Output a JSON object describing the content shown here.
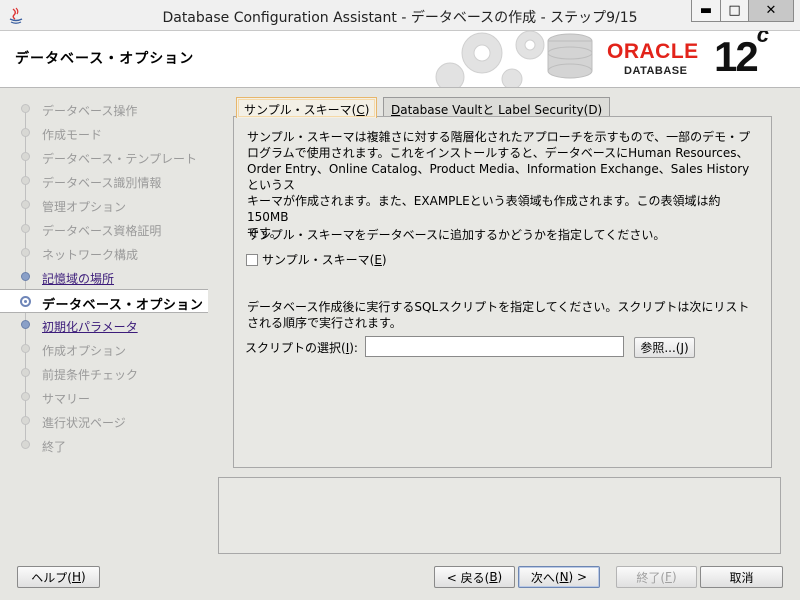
{
  "window": {
    "title": "Database Configuration Assistant - データベースの作成 - ステップ9/15",
    "minimize_glyph": "▬",
    "maximize_glyph": "□",
    "close_glyph": "✕"
  },
  "header": {
    "title": "データベース・オプション",
    "brand": "ORACLE",
    "brand_sub": "DATABASE",
    "version": "12",
    "version_suffix": "c"
  },
  "steps": [
    {
      "label": "データベース操作",
      "state": "disabled"
    },
    {
      "label": "作成モード",
      "state": "disabled"
    },
    {
      "label": "データベース・テンプレート",
      "state": "disabled"
    },
    {
      "label": "データベース識別情報",
      "state": "disabled"
    },
    {
      "label": "管理オプション",
      "state": "disabled"
    },
    {
      "label": "データベース資格証明",
      "state": "disabled"
    },
    {
      "label": "ネットワーク構成",
      "state": "disabled"
    },
    {
      "label": "記憶域の場所",
      "state": "link"
    },
    {
      "label": "データベース・オプション",
      "state": "current"
    },
    {
      "label": "初期化パラメータ",
      "state": "link"
    },
    {
      "label": "作成オプション",
      "state": "disabled"
    },
    {
      "label": "前提条件チェック",
      "state": "disabled"
    },
    {
      "label": "サマリー",
      "state": "disabled"
    },
    {
      "label": "進行状況ページ",
      "state": "disabled"
    },
    {
      "label": "終了",
      "state": "disabled"
    }
  ],
  "tabs": [
    {
      "label": "サンプル・スキーマ(",
      "mnemonic": "C",
      "suffix": ")",
      "active": true
    },
    {
      "label": "",
      "mnemonic": "D",
      "label_rest": "atabase Vaultと Label Security(",
      "suffix": "D)",
      "active": false
    }
  ],
  "tab_labels": {
    "sample_prefix": "サンプル・スキーマ(",
    "sample_key": "C",
    "sample_suffix": ")",
    "vault_key": "D",
    "vault_rest": "atabase Vaultと Label Security(D)"
  },
  "panel": {
    "description_line1": "サンプル・スキーマは複雑さに対する階層化されたアプローチを示すもので、一部のデモ・プ",
    "description_line2": "ログラムで使用されます。これをインストールすると、データベースにHuman Resources、",
    "description_line3": "Order Entry、Online Catalog、Product Media、Information Exchange、Sales Historyというス",
    "description_line4": "キーマが作成されます。また、EXAMPLEという表領域も作成されます。この表領域は約150MB",
    "description_line5": "です。",
    "add_prompt": "サンプル・スキーマをデータベースに追加するかどうかを指定してください。",
    "checkbox_label": "サンプル・スキーマ(",
    "checkbox_key": "E",
    "checkbox_suffix": ")",
    "checkbox_checked": false,
    "sql_prompt_line1": "データベース作成後に実行するSQLスクリプトを指定してください。スクリプトは次にリスト",
    "sql_prompt_line2": "される順序で実行されます。",
    "script_label": "スクリプトの選択(",
    "script_key": "I",
    "script_suffix": "):",
    "script_value": "",
    "browse_label": "参照...(",
    "browse_key": "J",
    "browse_suffix": ")"
  },
  "buttons": {
    "help": "ヘルプ(",
    "help_key": "H",
    "help_suffix": ")",
    "back": "< 戻る(",
    "back_key": "B",
    "back_suffix": ")",
    "next": "次へ(",
    "next_key": "N",
    "next_suffix": ") >",
    "finish": "終了(",
    "finish_key": "F",
    "finish_suffix": ")",
    "cancel": "取消"
  }
}
